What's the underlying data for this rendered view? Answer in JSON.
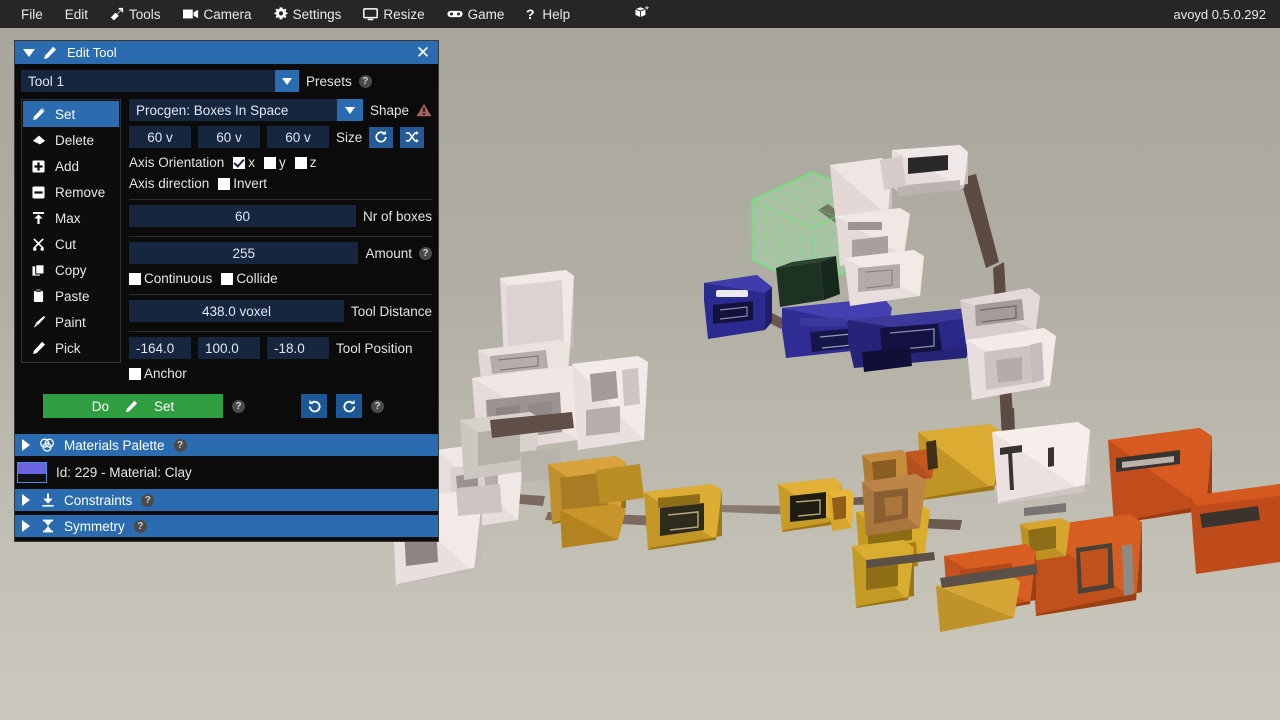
{
  "app": {
    "version_label": "avoyd 0.5.0.292",
    "center_icon": "cube-asterisk-icon"
  },
  "menubar": {
    "items": [
      {
        "label": "File",
        "icon": ""
      },
      {
        "label": "Edit",
        "icon": ""
      },
      {
        "label": "Tools",
        "icon": "hammer-icon"
      },
      {
        "label": "Camera",
        "icon": "video-camera-icon"
      },
      {
        "label": "Settings",
        "icon": "gear-icon"
      },
      {
        "label": "Resize",
        "icon": "monitor-icon"
      },
      {
        "label": "Game",
        "icon": "goggles-icon"
      },
      {
        "label": "Help",
        "icon": "question-mark-icon"
      }
    ]
  },
  "edit_panel": {
    "title": "Edit Tool",
    "title_icon": "pencil-icon",
    "collapse_icon": "triangle-down-icon",
    "close_icon": "close-icon",
    "preset": {
      "value": "Tool 1",
      "label": "Presets",
      "help": "?"
    },
    "tools": [
      {
        "label": "Set",
        "icon": "pencil-icon",
        "selected": true
      },
      {
        "label": "Delete",
        "icon": "eraser-icon",
        "selected": false
      },
      {
        "label": "Add",
        "icon": "plus-box-icon",
        "selected": false
      },
      {
        "label": "Remove",
        "icon": "minus-box-icon",
        "selected": false
      },
      {
        "label": "Max",
        "icon": "arrow-up-bar-icon",
        "selected": false
      },
      {
        "label": "Cut",
        "icon": "scissors-icon",
        "selected": false
      },
      {
        "label": "Copy",
        "icon": "copy-icon",
        "selected": false
      },
      {
        "label": "Paste",
        "icon": "clipboard-icon",
        "selected": false
      },
      {
        "label": "Paint",
        "icon": "paintbrush-icon",
        "selected": false
      },
      {
        "label": "Pick",
        "icon": "eyedropper-icon",
        "selected": false
      }
    ],
    "shape": {
      "value": "Procgen: Boxes In Space",
      "label": "Shape",
      "warning_icon": "warning-triangle-icon"
    },
    "size": {
      "label": "Size",
      "x": "60 v",
      "y": "60 v",
      "z": "60 v",
      "reset_icon": "refresh-icon",
      "random_icon": "shuffle-icon"
    },
    "axis_orientation": {
      "label": "Axis Orientation",
      "x": {
        "label": "x",
        "checked": true
      },
      "y": {
        "label": "y",
        "checked": false
      },
      "z": {
        "label": "z",
        "checked": false
      }
    },
    "axis_direction": {
      "label": "Axis direction",
      "invert": {
        "label": "Invert",
        "checked": false
      }
    },
    "nr_of_boxes": {
      "value": "60",
      "label": "Nr of boxes"
    },
    "amount": {
      "value": "255",
      "label": "Amount",
      "help": "?"
    },
    "continuous": {
      "label": "Continuous",
      "checked": false
    },
    "collide": {
      "label": "Collide",
      "checked": false
    },
    "tool_distance": {
      "value": "438.0 voxel",
      "label": "Tool Distance"
    },
    "tool_position": {
      "label": "Tool Position",
      "x": "-164.0",
      "y": "100.0",
      "z": "-18.0"
    },
    "anchor": {
      "label": "Anchor",
      "checked": false
    },
    "actions": {
      "do_label": "Do",
      "do_icon": "pencil-icon",
      "do_action_label": "Set",
      "do_help": "?",
      "undo_icon": "undo-icon",
      "redo_icon": "redo-icon",
      "undo_help": "?"
    },
    "sections": [
      {
        "label": "Materials Palette",
        "icon": "palette-icon",
        "help": "?",
        "expanded": false
      },
      {
        "label": "Constraints",
        "icon": "download-icon",
        "help": "?",
        "expanded": false
      },
      {
        "label": "Symmetry",
        "icon": "hourglass-icon",
        "help": "?",
        "expanded": false
      }
    ],
    "material": {
      "text": "Id: 229 - Material: Clay",
      "swatch_color": "#6a63e0"
    }
  },
  "colors": {
    "accent_blue": "#2b6cb0",
    "field_blue": "#16263f",
    "green_button": "#2f9e41",
    "menubar_bg": "#262626",
    "panel_bg": "#0b0b0b",
    "viewport_bg_top": "#a9a69c",
    "viewport_bg_bottom": "#cbc9be"
  },
  "viewport": {
    "scene_description": "3D voxel scene with clusters of boxes",
    "selection_box_color": "#5bf06a"
  }
}
